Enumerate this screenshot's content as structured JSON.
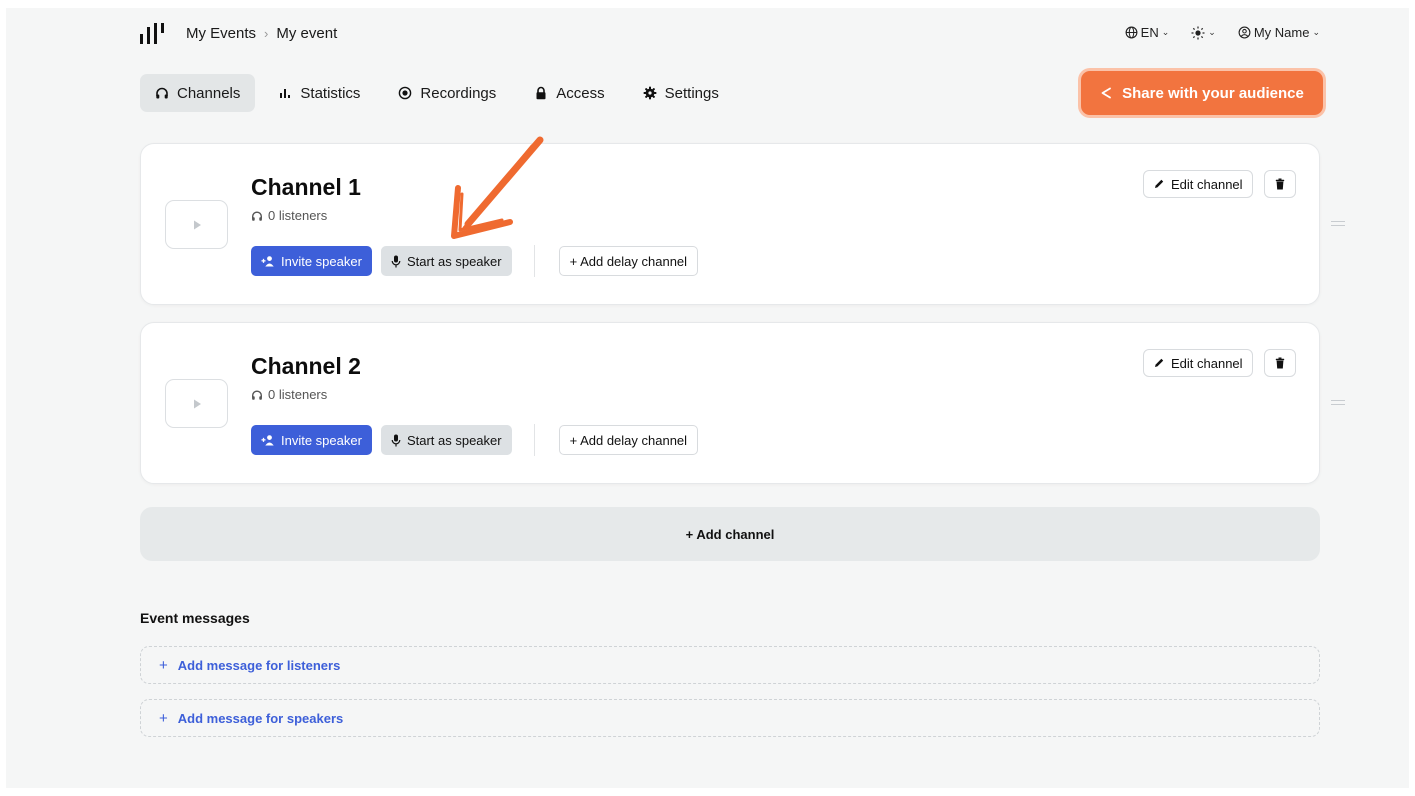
{
  "header": {
    "breadcrumb": [
      "My Events",
      "My event"
    ],
    "breadcrumb_sep": "›",
    "language": "EN",
    "user": "My Name"
  },
  "tabs": [
    {
      "label": "Channels",
      "icon": "headphones-icon",
      "active": true
    },
    {
      "label": "Statistics",
      "icon": "bar-chart-icon",
      "active": false
    },
    {
      "label": "Recordings",
      "icon": "record-icon",
      "active": false
    },
    {
      "label": "Access",
      "icon": "lock-icon",
      "active": false
    },
    {
      "label": "Settings",
      "icon": "gear-icon",
      "active": false
    }
  ],
  "share_button": "Share with your audience",
  "channels": [
    {
      "title": "Channel 1",
      "listeners": "0 listeners",
      "invite_label": "Invite speaker",
      "start_label": "Start as speaker",
      "delay_label": "+ Add delay channel",
      "edit_label": "Edit channel"
    },
    {
      "title": "Channel 2",
      "listeners": "0 listeners",
      "invite_label": "Invite speaker",
      "start_label": "Start as speaker",
      "delay_label": "+ Add delay channel",
      "edit_label": "Edit channel"
    }
  ],
  "add_channel_label": "+ Add channel",
  "event_messages": {
    "heading": "Event messages",
    "listeners_label": "Add message for listeners",
    "speakers_label": "Add message for speakers"
  },
  "colors": {
    "accent_orange": "#f2743f",
    "accent_blue": "#3d5fd9",
    "background": "#f5f6f6"
  }
}
